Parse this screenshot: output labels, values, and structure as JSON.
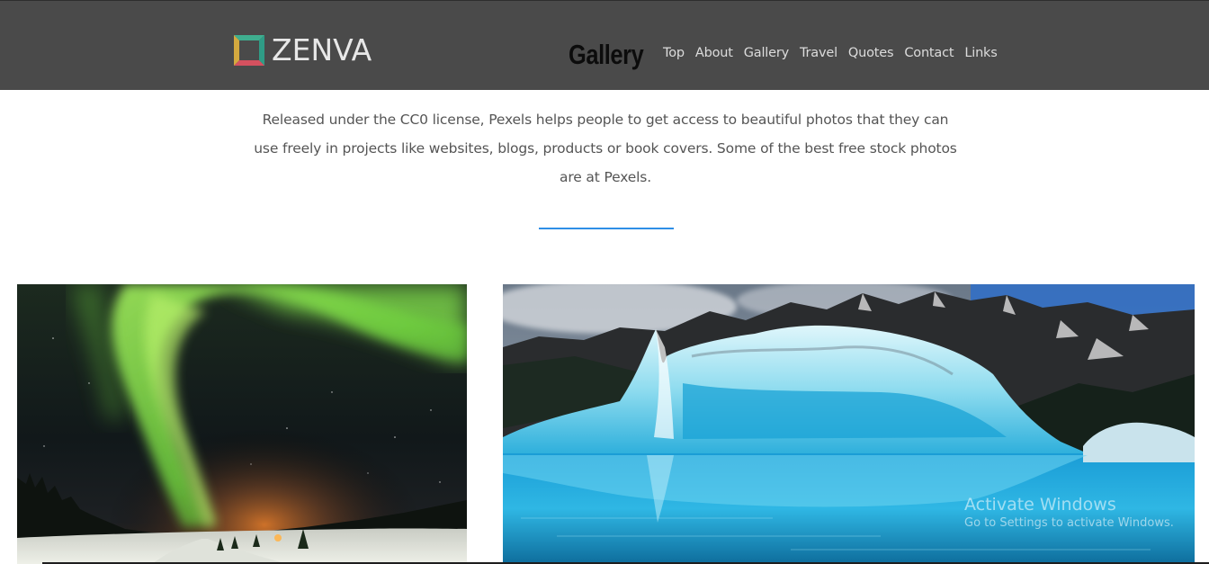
{
  "header": {
    "brand_name": "ZENVA",
    "section_title": "Gallery",
    "background_color": "#4a4a4a",
    "nav": [
      {
        "label": "Top"
      },
      {
        "label": "About"
      },
      {
        "label": "Gallery"
      },
      {
        "label": "Travel"
      },
      {
        "label": "Quotes"
      },
      {
        "label": "Contact"
      },
      {
        "label": "Links"
      }
    ]
  },
  "intro": {
    "lines": [
      "Released under the CC0 license, Pexels helps people to get access to beautiful photos that they can",
      "use freely in projects like websites, blogs, products or book covers. Some of the best free stock photos",
      "are at Pexels."
    ],
    "divider_color": "#2f8fe6"
  },
  "gallery": {
    "photos": [
      {
        "subject": "northern lights over snowy road"
      },
      {
        "subject": "blue iceberg in mountain lake"
      }
    ]
  },
  "watermark": {
    "title": "Activate Windows",
    "subtitle": "Go to Settings to activate Windows."
  }
}
